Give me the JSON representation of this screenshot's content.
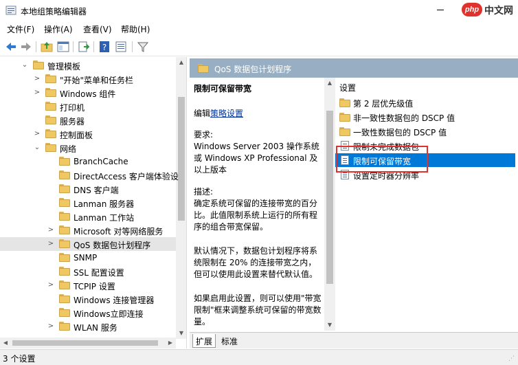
{
  "window": {
    "title": "本地组策略编辑器",
    "watermark_logo": "php",
    "watermark_text": "中文网"
  },
  "menu": {
    "file": "文件(F)",
    "action": "操作(A)",
    "view": "查看(V)",
    "help": "帮助(H)"
  },
  "toolbar": {
    "icons": [
      "back-arrow-icon",
      "forward-arrow-icon",
      "up-folder-icon",
      "show-hide-tree-icon",
      "export-list-icon",
      "help-icon",
      "properties-icon",
      "filter-icon"
    ]
  },
  "tree": {
    "items": [
      {
        "label": "管理模板",
        "expander": "⌄",
        "depth": 0
      },
      {
        "label": "\"开始\"菜单和任务栏",
        "expander": ">",
        "depth": 1
      },
      {
        "label": "Windows 组件",
        "expander": ">",
        "depth": 1
      },
      {
        "label": "打印机",
        "expander": "",
        "depth": 1
      },
      {
        "label": "服务器",
        "expander": "",
        "depth": 1
      },
      {
        "label": "控制面板",
        "expander": ">",
        "depth": 1
      },
      {
        "label": "网络",
        "expander": "⌄",
        "depth": 1
      },
      {
        "label": "BranchCache",
        "expander": "",
        "depth": 2
      },
      {
        "label": "DirectAccess 客户端体验设",
        "expander": "",
        "depth": 2
      },
      {
        "label": "DNS 客户端",
        "expander": "",
        "depth": 2
      },
      {
        "label": "Lanman 服务器",
        "expander": "",
        "depth": 2
      },
      {
        "label": "Lanman 工作站",
        "expander": "",
        "depth": 2
      },
      {
        "label": "Microsoft 对等网络服务",
        "expander": ">",
        "depth": 2
      },
      {
        "label": "QoS 数据包计划程序",
        "expander": ">",
        "depth": 2,
        "selected": true
      },
      {
        "label": "SNMP",
        "expander": "",
        "depth": 2
      },
      {
        "label": "SSL 配置设置",
        "expander": "",
        "depth": 2
      },
      {
        "label": "TCPIP 设置",
        "expander": ">",
        "depth": 2
      },
      {
        "label": "Windows 连接管理器",
        "expander": "",
        "depth": 2
      },
      {
        "label": "Windows立即连接",
        "expander": "",
        "depth": 2
      },
      {
        "label": "WLAN 服务",
        "expander": ">",
        "depth": 2
      }
    ]
  },
  "right_header": {
    "title": "QoS 数据包计划程序"
  },
  "description": {
    "title": "限制可保留带宽",
    "edit_prefix": "编辑",
    "edit_link": "策略设置",
    "requirements": "要求:\nWindows Server 2003 操作系统或 Windows XP Professional 及以上版本",
    "description": "描述:\n确定系统可保留的连接带宽的百分比。此值限制系统上运行的所有程序的组合带宽保留。",
    "default_text": "默认情况下，数据包计划程序将系统限制在 20% 的连接带宽之内，但可以使用此设置来替代默认值。",
    "enabled_text": "如果启用此设置，则可以使用\"带宽限制\"框来调整系统可保留的带宽数量。"
  },
  "settings_list": {
    "column_header": "设置",
    "items": [
      {
        "label": "第 2 层优先级值",
        "kind": "folder"
      },
      {
        "label": "非一致性数据包的 DSCP 值",
        "kind": "folder"
      },
      {
        "label": "一致性数据包的 DSCP 值",
        "kind": "folder"
      },
      {
        "label": "限制未完成数据包",
        "kind": "setting"
      },
      {
        "label": "限制可保留带宽",
        "kind": "setting",
        "selected": true
      },
      {
        "label": "设置定时器分辨率",
        "kind": "setting"
      }
    ]
  },
  "tabs": {
    "extended": "扩展",
    "standard": "标准"
  },
  "status": {
    "text": "3 个设置"
  },
  "colors": {
    "accent": "#0078d7",
    "header_bg": "#98aec2",
    "highlight_box": "#e0312d",
    "link": "#003399"
  }
}
